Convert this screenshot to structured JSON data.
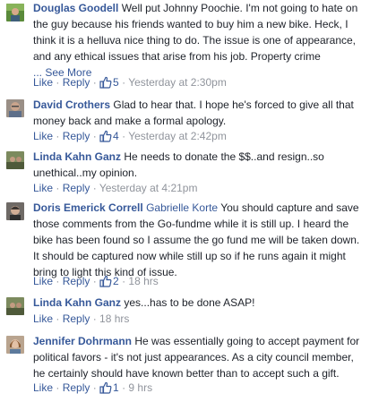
{
  "comments": [
    {
      "author": "Douglas Goodell",
      "text": "Well put Johnny Poochie. I'm not going to hate on the guy because his friends wanted to buy him a new bike. Heck, I think it is a helluva nice thing to do. The issue is one of appearance, and any ethical issues that arise from his job. Property crime",
      "see_more": "... See More",
      "like": "Like",
      "reply": "Reply",
      "likes": "5",
      "time": "Yesterday at 2:30pm"
    },
    {
      "author": "David Crothers",
      "text": "Glad to hear that. I hope he's forced to give all that money back and make a formal apology.",
      "like": "Like",
      "reply": "Reply",
      "likes": "4",
      "time": "Yesterday at 2:42pm"
    },
    {
      "author": "Linda Kahn Ganz",
      "text": "He needs to donate the $$..and resign..so unethical..my opinion.",
      "like": "Like",
      "reply": "Reply",
      "time": "Yesterday at 4:21pm"
    },
    {
      "author": "Doris Emerick Correll",
      "tagged": "Gabrielle Korte",
      "text": "You should capture and save those comments from the Go-fundme while it is still up. I heard the bike has been found so I assume the go fund me will be taken down. It should be captured now while still up so if he runs again it might bring to light this kind of issue.",
      "like": "Like",
      "reply": "Reply",
      "likes": "2",
      "time": "18 hrs"
    },
    {
      "author": "Linda Kahn Ganz",
      "text": "yes...has to be done ASAP!",
      "like": "Like",
      "reply": "Reply",
      "time": "18 hrs"
    },
    {
      "author": "Jennifer Dohrmann",
      "text": "He was essentially going to accept payment for political favors - it's not just appearances. As a city council member, he certainly should have known better than to accept such a gift.",
      "like": "Like",
      "reply": "Reply",
      "likes": "1",
      "time": "9 hrs"
    }
  ],
  "colors": {
    "link": "#365899",
    "meta": "#90949c",
    "text": "#1d2129"
  }
}
